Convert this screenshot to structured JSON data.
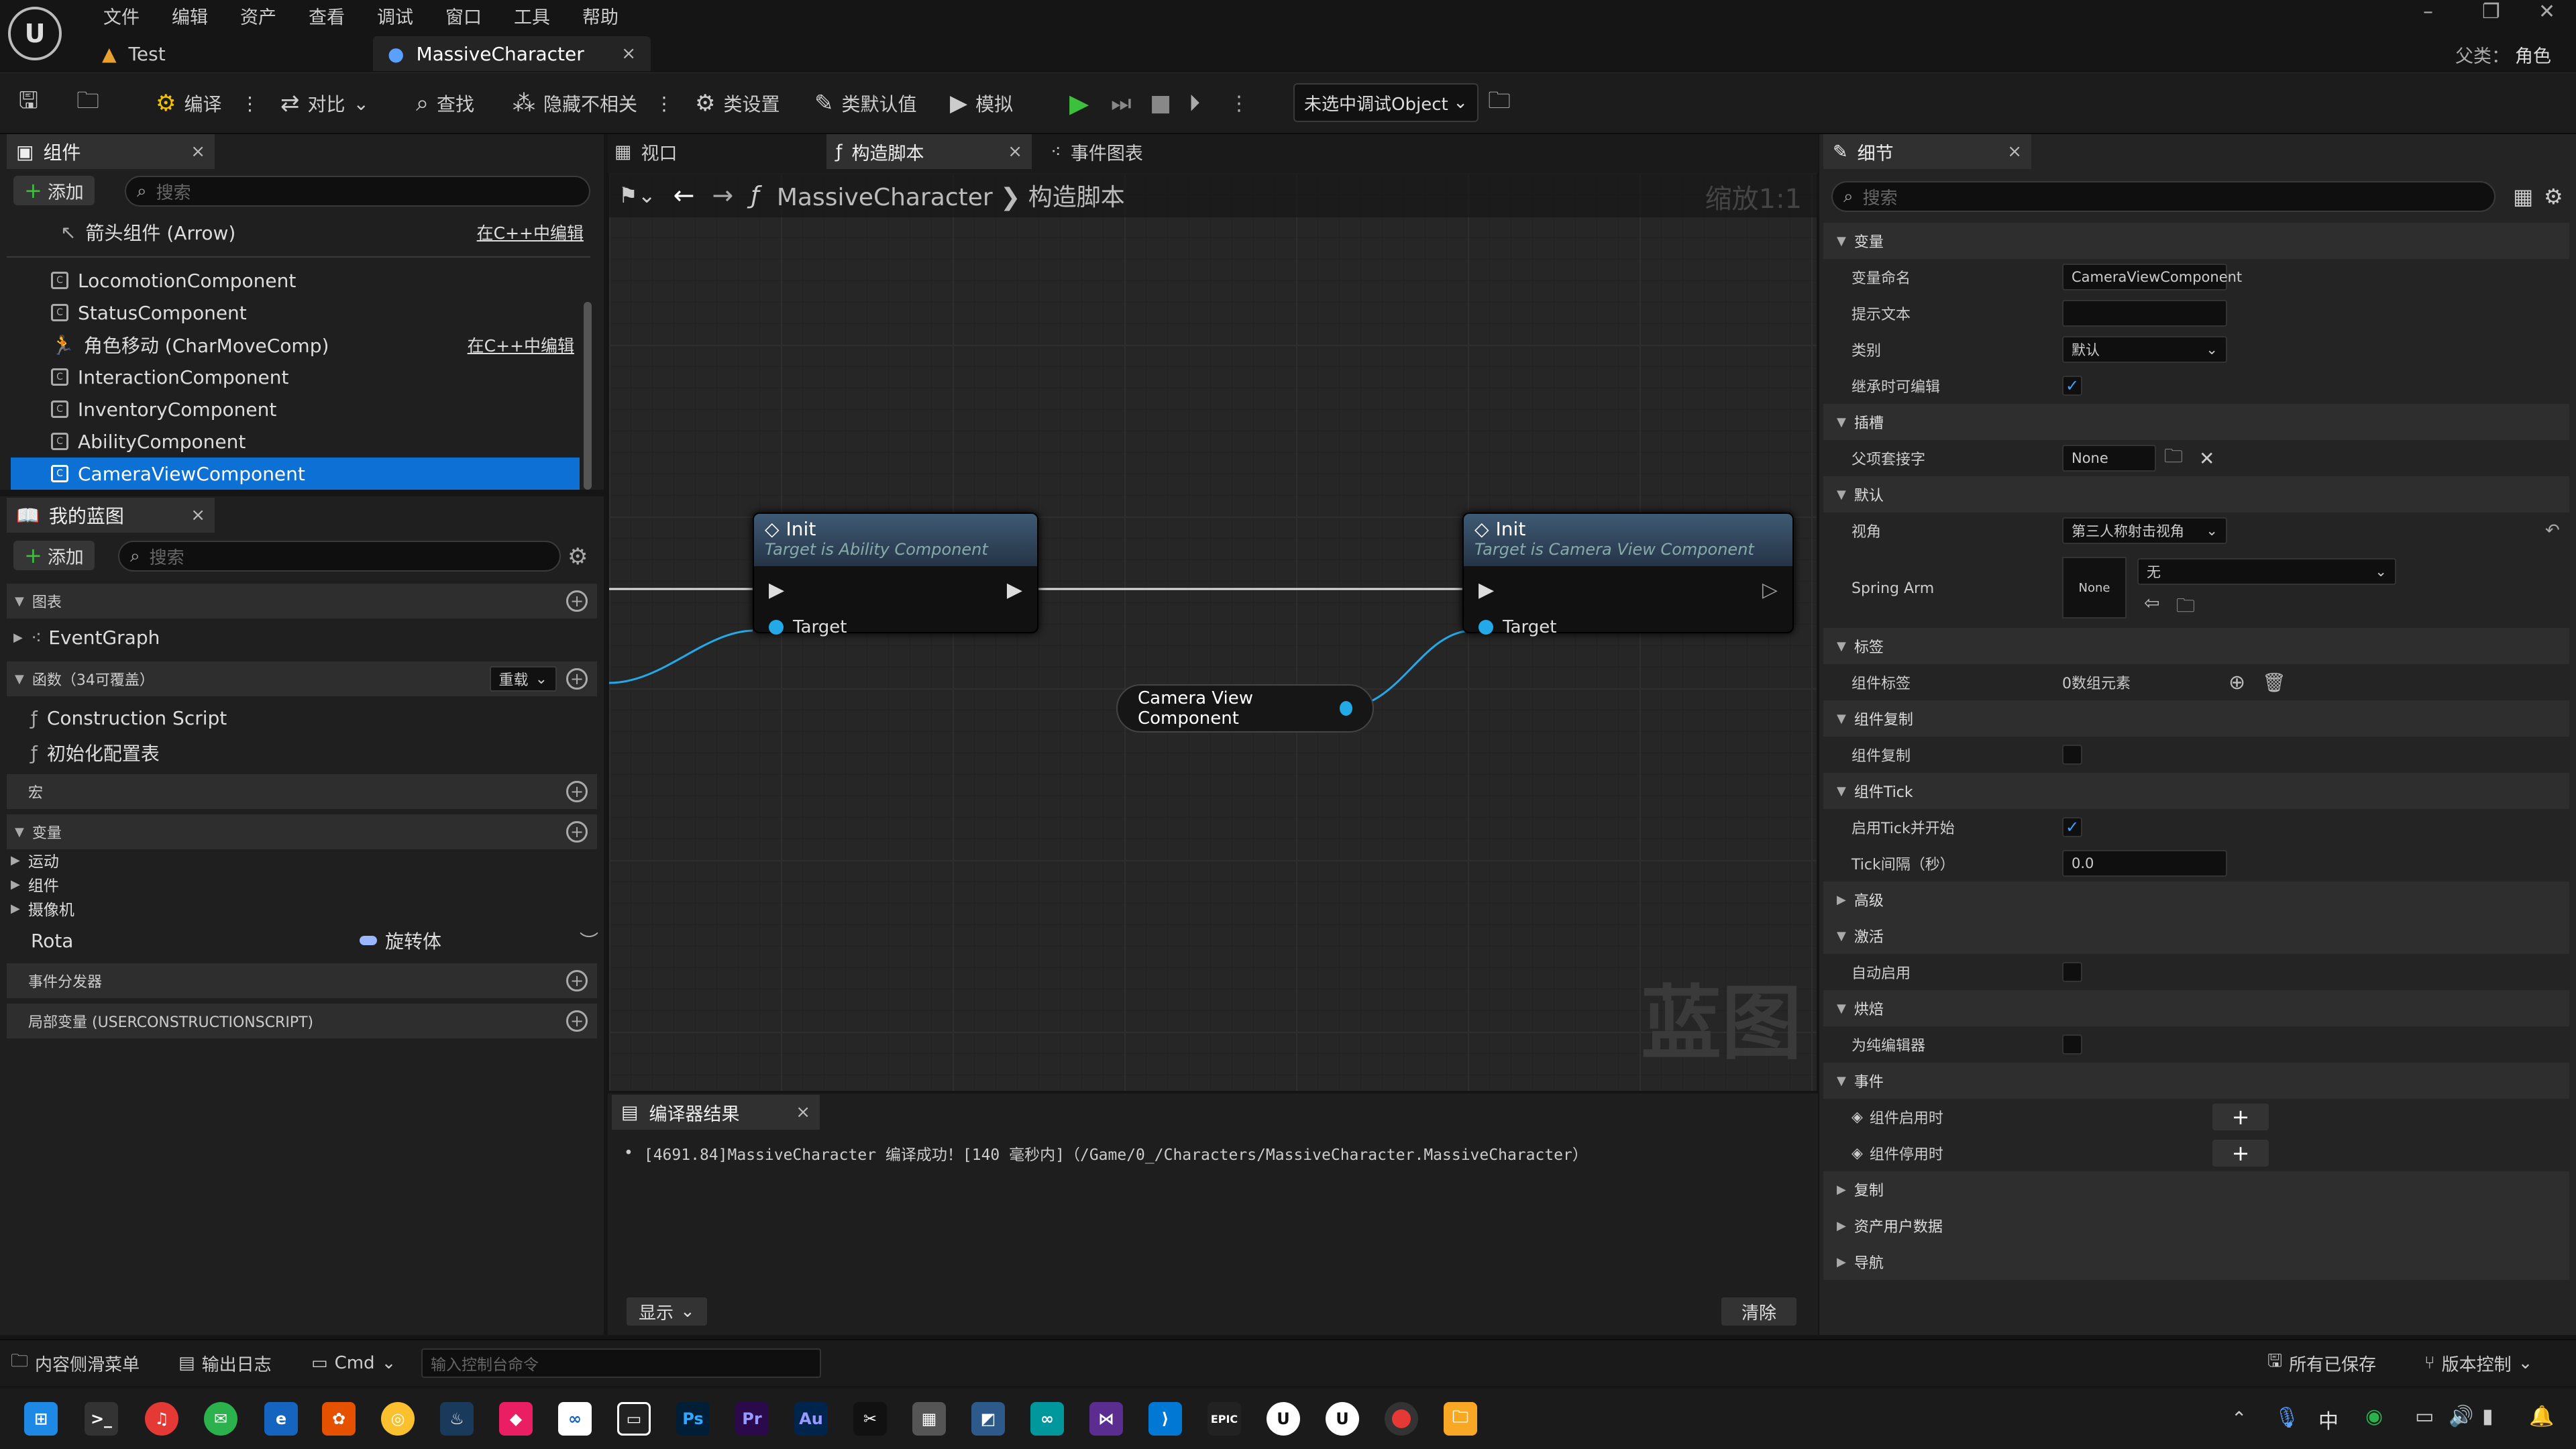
{
  "menu": [
    "文件",
    "编辑",
    "资产",
    "查看",
    "调试",
    "窗口",
    "工具",
    "帮助"
  ],
  "tabs": {
    "test": "Test",
    "massive": "MassiveCharacter"
  },
  "parent": {
    "label": "父类：",
    "value": "角色"
  },
  "toolbar": {
    "compile": "编译",
    "diff": "对比",
    "find": "查找",
    "hide_unrelated": "隐藏不相关",
    "class_settings": "类设置",
    "class_defaults": "类默认值",
    "simulate": "模拟",
    "debug_object": "未选中调试Object"
  },
  "components": {
    "title": "组件",
    "add": "添加",
    "search_placeholder": "搜索",
    "arrow": "箭头组件 (Arrow)",
    "edit_in_cpp": "在C++中编辑",
    "items": [
      "LocomotionComponent",
      "StatusComponent",
      "角色移动 (CharMoveComp)",
      "InteractionComponent",
      "InventoryComponent",
      "AbilityComponent",
      "CameraViewComponent"
    ]
  },
  "my_blueprint": {
    "title": "我的蓝图",
    "add": "添加",
    "search_placeholder": "搜索",
    "graphs": "图表",
    "event_graph": "EventGraph",
    "functions": "函数（34可覆盖）",
    "override": "重载",
    "construction_script": "Construction Script",
    "init_config_table": "初始化配置表",
    "macros": "宏",
    "variables": "变量",
    "var_groups": [
      "运动",
      "组件",
      "摄像机"
    ],
    "rota_name": "Rota",
    "rota_type": "旋转体",
    "event_dispatchers": "事件分发器",
    "local_vars": "局部变量 (USERCONSTRUCTIONSCRIPT)"
  },
  "graph_tabs": {
    "viewport": "视口",
    "construction": "构造脚本",
    "event_graph": "事件图表"
  },
  "graph": {
    "breadcrumb_class": "MassiveCharacter",
    "breadcrumb_graph": "构造脚本",
    "zoom": "缩放1:1",
    "watermark": "蓝图",
    "node1_title": "Init",
    "node1_sub": "Target is Ability Component",
    "node2_title": "Init",
    "node2_sub": "Target is Camera View Component",
    "target": "Target",
    "var_node": "Camera View Component"
  },
  "compiler": {
    "title": "编译器结果",
    "message": "[4691.84]MassiveCharacter 编译成功！[140 毫秒内]（/Game/0_/Characters/MassiveCharacter.MassiveCharacter）",
    "show": "显示",
    "clear": "清除"
  },
  "details": {
    "title": "细节",
    "search_placeholder": "搜索",
    "cat_variable": "变量",
    "var_name_label": "变量命名",
    "var_name_value": "CameraViewComponent",
    "tooltip_label": "提示文本",
    "category_label": "类别",
    "category_value": "默认",
    "editable_label": "继承时可编辑",
    "cat_sockets": "插槽",
    "parent_socket_label": "父项套接字",
    "parent_socket_value": "None",
    "cat_default": "默认",
    "view_label": "视角",
    "view_value": "第三人称射击视角",
    "spring_arm_label": "Spring Arm",
    "spring_arm_thumb": "None",
    "spring_arm_value": "无",
    "cat_tags": "标签",
    "comp_tags_label": "组件标签",
    "comp_tags_value": "0数组元素",
    "cat_replication": "组件复制",
    "replicates_label": "组件复制",
    "cat_tick": "组件Tick",
    "tick_start_label": "启用Tick并开始",
    "tick_interval_label": "Tick间隔（秒）",
    "tick_interval_value": "0.0",
    "cat_advanced": "高级",
    "cat_activation": "激活",
    "auto_activate_label": "自动启用",
    "cat_cooking": "烘焙",
    "editor_only_label": "为纯编辑器",
    "cat_events": "事件",
    "on_activated": "组件启用时",
    "on_deactivated": "组件停用时",
    "cat_replication2": "复制",
    "cat_asset_user_data": "资产用户数据",
    "cat_navigation": "导航"
  },
  "status": {
    "content_drawer": "内容侧滑菜单",
    "output_log": "输出日志",
    "cmd": "Cmd",
    "console_placeholder": "输入控制台命令",
    "all_saved": "所有已保存",
    "source_control": "版本控制"
  },
  "taskbar": {
    "ime": "中"
  }
}
